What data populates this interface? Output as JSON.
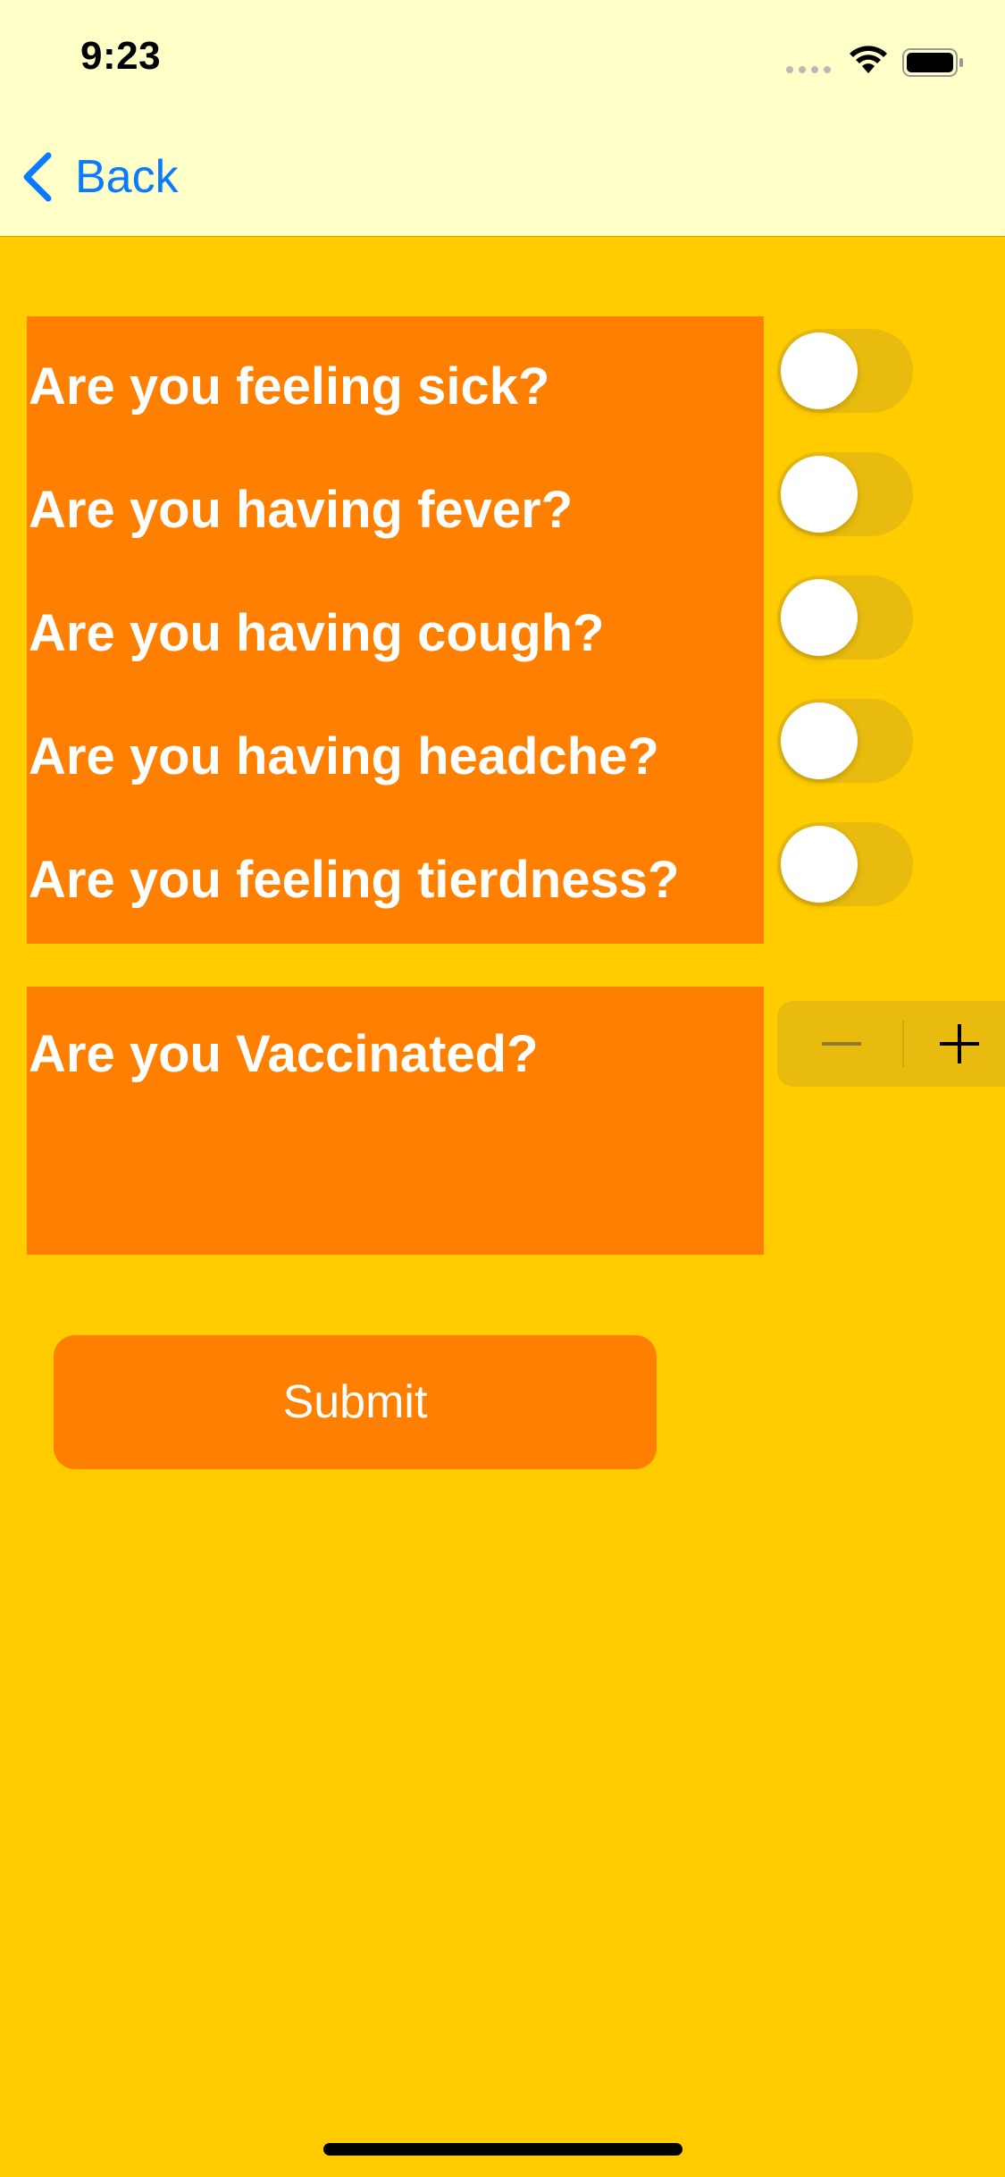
{
  "status_bar": {
    "time": "9:23"
  },
  "nav": {
    "back_label": "Back"
  },
  "questions": [
    {
      "label": "Are you feeling sick?",
      "on": false
    },
    {
      "label": "Are you having fever?",
      "on": false
    },
    {
      "label": "Are you having cough?",
      "on": false
    },
    {
      "label": "Are you having headche?",
      "on": false
    },
    {
      "label": "Are you feeling tierdness?",
      "on": false
    }
  ],
  "vaccination": {
    "label": "Are you Vaccinated?"
  },
  "submit_label": "Submit",
  "colors": {
    "background": "#ffcc00",
    "bar_background": "#ffffc8",
    "panel": "#ff7f00",
    "accent": "#0a7aff",
    "toggle_track": "#e9bb0f"
  }
}
